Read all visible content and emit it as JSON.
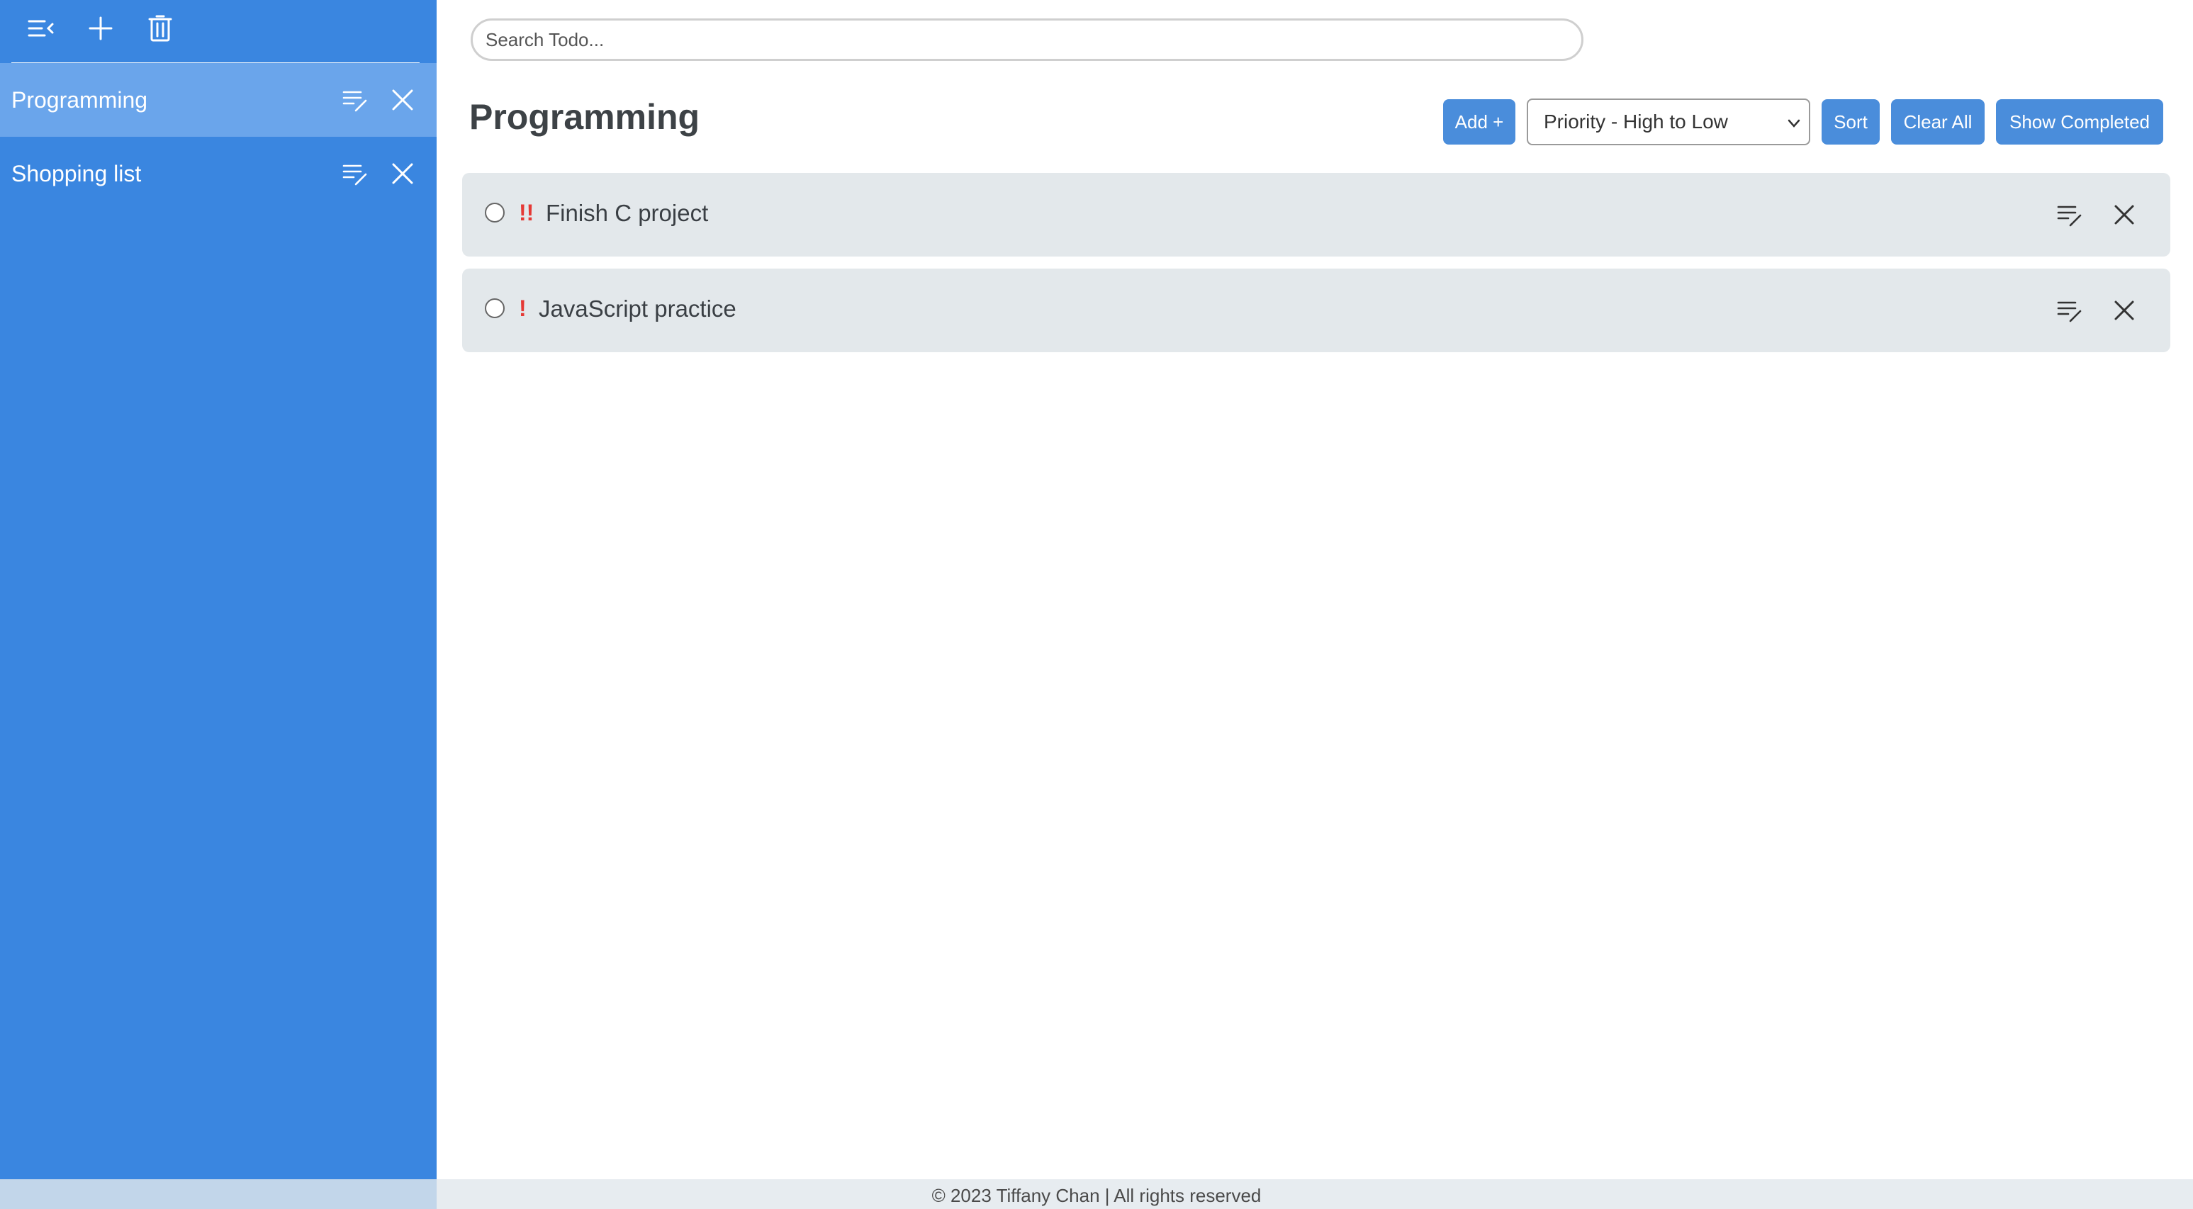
{
  "sidebar": {
    "toolbar": {
      "collapse_icon": "collapse-menu-icon",
      "add_icon": "plus-icon",
      "delete_icon": "trash-icon"
    },
    "lists": [
      {
        "label": "Programming",
        "active": true
      },
      {
        "label": "Shopping list",
        "active": false
      }
    ]
  },
  "search": {
    "placeholder": "Search Todo...",
    "value": ""
  },
  "main": {
    "title": "Programming",
    "add_label": "Add +",
    "sort_select": {
      "selected": "Priority - High to Low"
    },
    "sort_label": "Sort",
    "clear_label": "Clear All",
    "show_completed_label": "Show Completed"
  },
  "todos": [
    {
      "priority": "!!",
      "text": "Finish C project",
      "completed": false
    },
    {
      "priority": "!",
      "text": "JavaScript practice",
      "completed": false
    }
  ],
  "footer": {
    "text": "© 2023 Tiffany Chan | All rights reserved"
  },
  "colors": {
    "sidebar": "#3a86e0",
    "sidebar_active": "#6aa5eb",
    "button": "#4a8ddb",
    "todo_bg": "#e3e8eb",
    "priority": "#e53935"
  }
}
